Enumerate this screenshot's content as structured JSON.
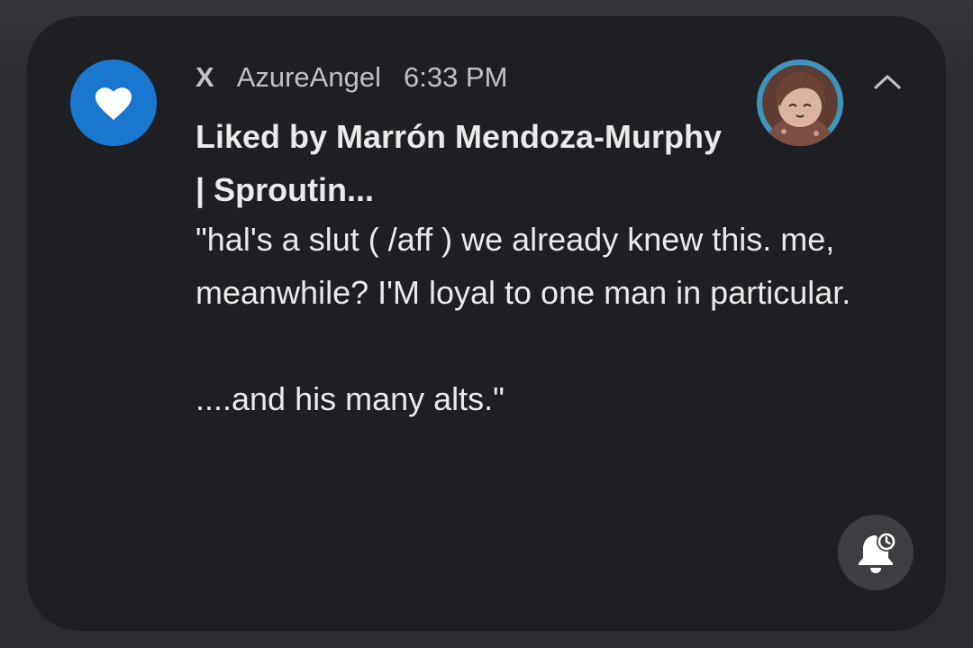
{
  "notification": {
    "app_name": "X",
    "sender": "AzureAngel",
    "time": "6:33 PM",
    "title": "Liked by Marrón Mendoza-Murphy | Sproutin...",
    "message": "\"hal's a slut ( /aff ) we already knew this. me, meanwhile? I'M loyal to one man in particular.\n\n....and his many alts.\"",
    "app_icon": "heart-icon",
    "avatar": "user-avatar",
    "collapse_icon": "chevron-up-icon",
    "snooze_icon": "bell-snooze-icon"
  },
  "colors": {
    "card_background": "#1d1f22",
    "accent": "#1a77cf",
    "text_primary": "#e9eaec",
    "text_secondary": "#bfc1c5"
  }
}
